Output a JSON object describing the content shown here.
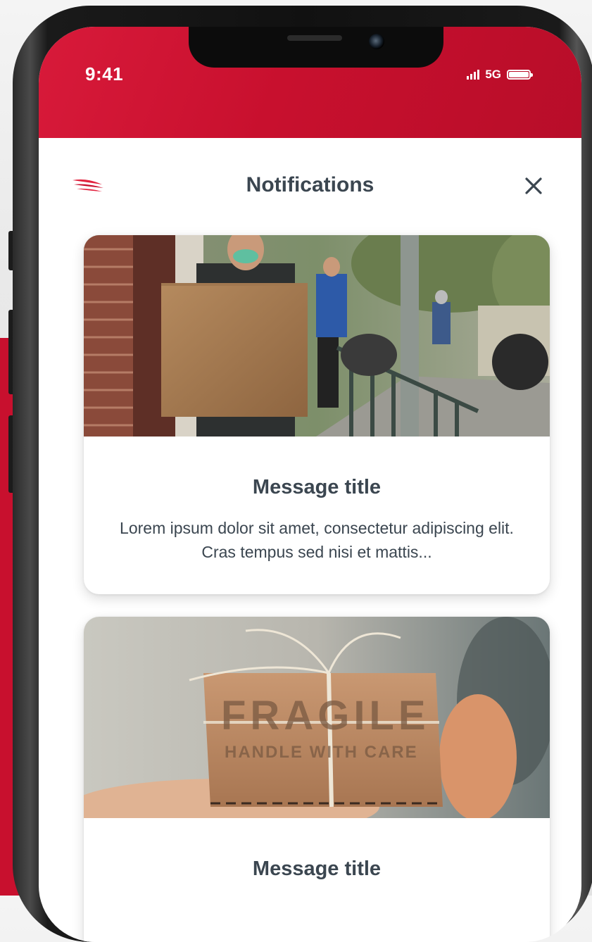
{
  "status_bar": {
    "time": "9:41",
    "network": "5G"
  },
  "header": {
    "title": "Notifications",
    "logo_icon": "brand-wing-logo",
    "close_icon": "close-icon"
  },
  "notifications": [
    {
      "image": "delivery-person-carrying-box-photo",
      "title": "Message title",
      "body": "Lorem ipsum dolor sit amet, consectetur adipiscing elit. Cras tempus sed nisi et mattis..."
    },
    {
      "image": "fragile-parcel-in-hand-photo",
      "image_text": "FRAGILE HANDLE WITH CARE",
      "title": "Message title"
    }
  ],
  "colors": {
    "brand_red": "#c8102e",
    "text_dark": "#3b4650"
  }
}
